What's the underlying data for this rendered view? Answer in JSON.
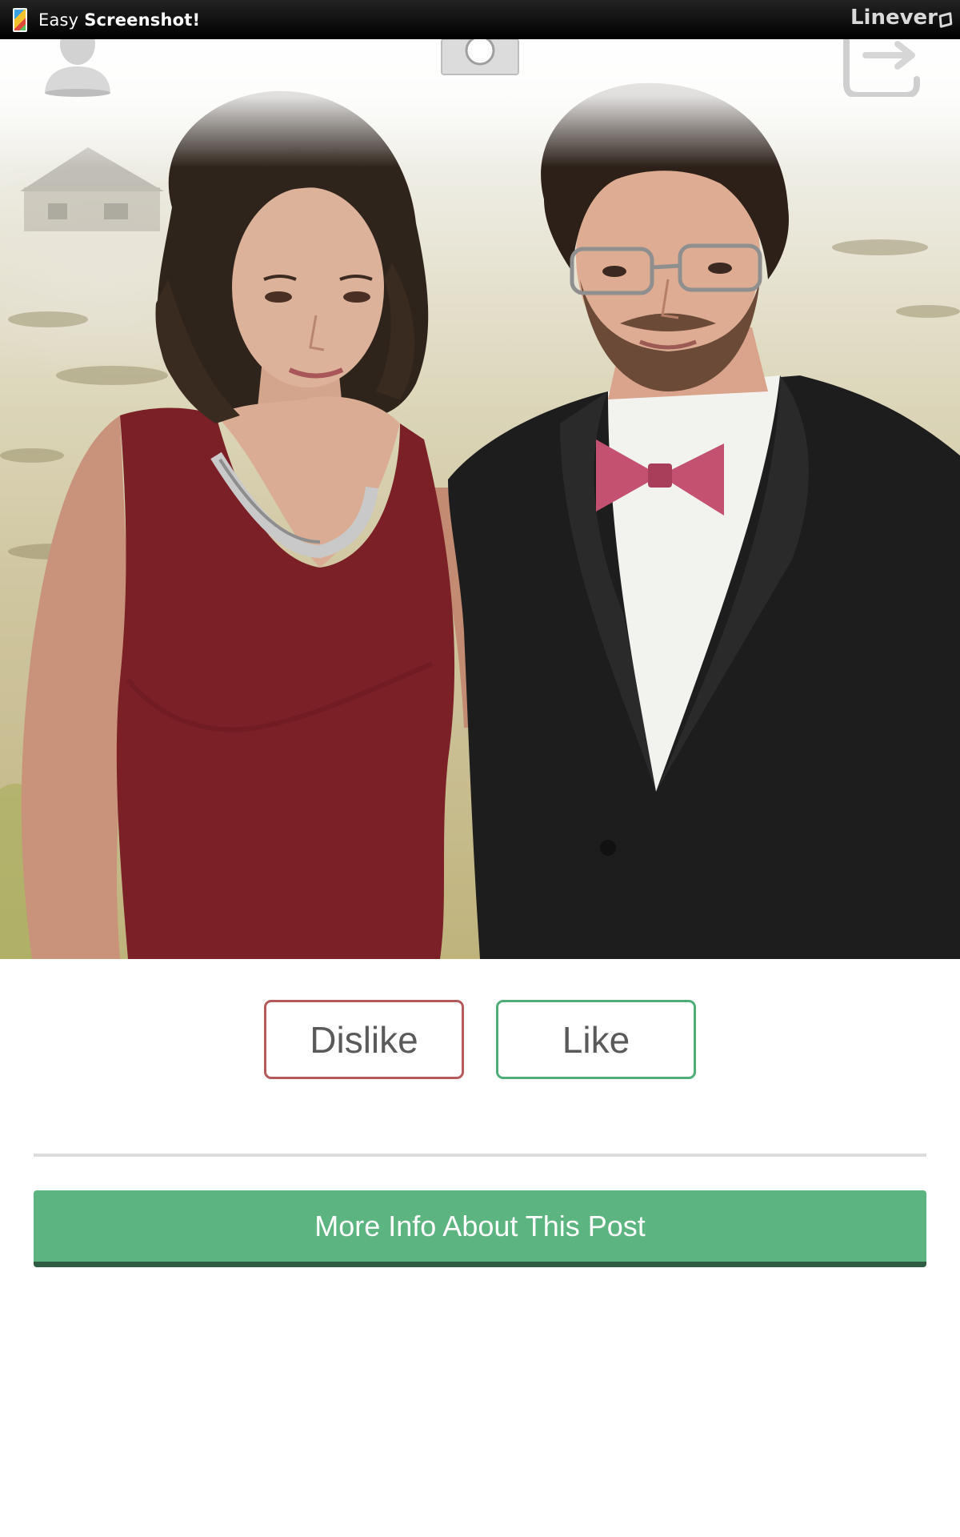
{
  "status_bar": {
    "app_name_regular": "Easy",
    "app_name_bold": "Screenshot!",
    "brand": "Linever"
  },
  "header_icons": {
    "profile": "profile-icon",
    "camera": "camera-icon",
    "logout": "logout-icon"
  },
  "post": {
    "photo_description": "Photo of a couple outdoors"
  },
  "actions": {
    "dislike_label": "Dislike",
    "like_label": "Like",
    "more_info_label": "More Info About This Post"
  },
  "colors": {
    "dislike_border": "#b55a5a",
    "like_border": "#4fae78",
    "primary_button": "#5cb481",
    "primary_button_shadow": "#2f5d43"
  }
}
